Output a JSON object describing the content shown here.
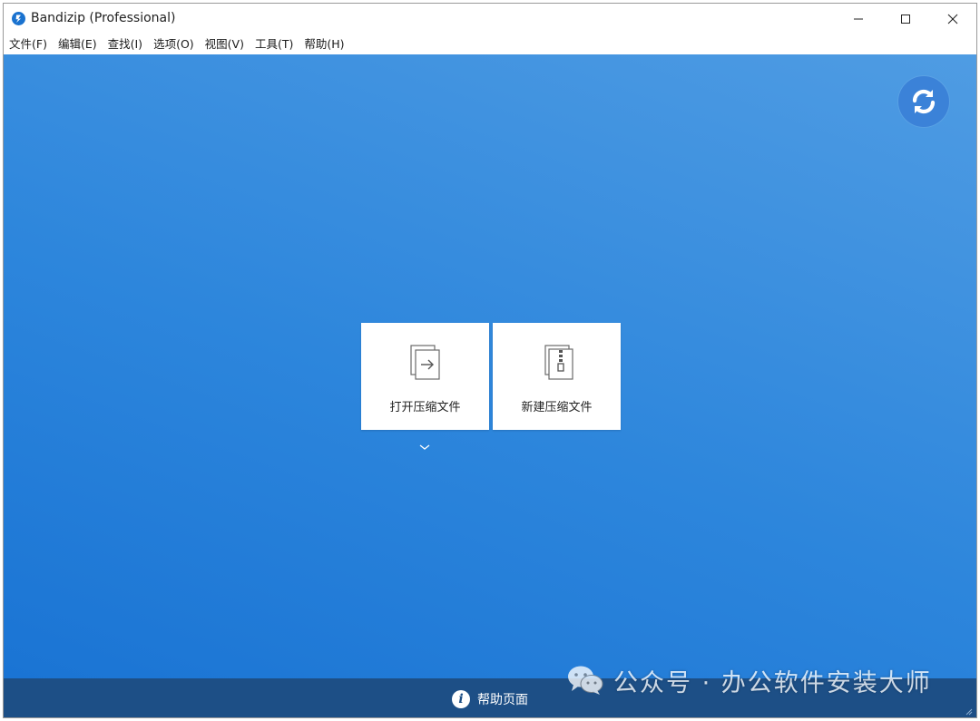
{
  "window": {
    "title": "Bandizip (Professional)"
  },
  "menu": [
    "文件(F)",
    "编辑(E)",
    "查找(I)",
    "选项(O)",
    "视图(V)",
    "工具(T)",
    "帮助(H)"
  ],
  "main": {
    "open_archive_label": "打开压缩文件",
    "new_archive_label": "新建压缩文件"
  },
  "footer": {
    "help_label": "帮助页面"
  },
  "watermark": {
    "text": "公众号 · 办公软件安装大师"
  },
  "icons": {
    "app": "bandizip-logo-icon",
    "refresh": "refresh-icon",
    "open": "open-archive-icon",
    "new": "new-archive-icon",
    "help": "info-icon",
    "dropdown": "chevron-down-icon"
  },
  "colors": {
    "background_gradient_start": "#1a74d4",
    "background_gradient_end": "#4f9ce3",
    "footer": "#1d4f86",
    "refresh_button": "#3b82d8",
    "card": "#ffffff"
  }
}
